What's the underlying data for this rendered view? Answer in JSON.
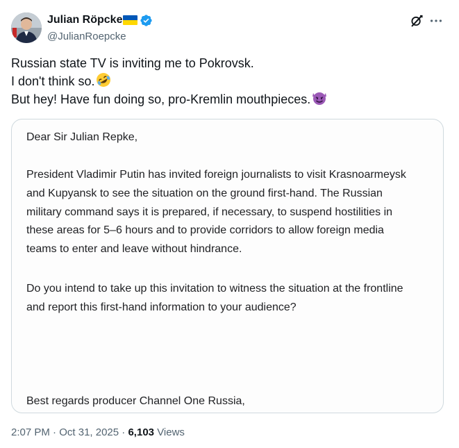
{
  "author": {
    "name": "Julian Röpcke",
    "handle": "@JulianRoepcke",
    "verified_color": "#1d9bf0"
  },
  "tweet": {
    "lines": [
      "Russian state TV is inviting me to Pokrovsk.",
      "I don't think so.",
      "But hey! Have fun doing so, pro-Kremlin mouthpieces."
    ],
    "emojis": [
      "rolling-on-floor-laughing",
      "smiling-face-with-horns"
    ]
  },
  "letter": {
    "greeting": "Dear Sir Julian Repke,",
    "body_lines": [
      "President Vladimir Putin has invited foreign journalists to visit Krasnoarmeysk",
      "and Kupyansk to see the situation on the ground first-hand. The Russian",
      "military command says it is prepared, if necessary, to suspend hostilities in",
      "these areas for 5–6 hours and to provide corridors to allow foreign media",
      "teams to enter and leave without hindrance."
    ],
    "question_lines": [
      "Do you intend to take up this invitation to witness the situation at the frontline",
      "and report this first-hand information to your audience?"
    ],
    "signoff": "Best regards producer Channel One Russia,"
  },
  "meta": {
    "time": "2:07 PM",
    "separator": "·",
    "date": "Oct 31, 2025",
    "views_count": "6,103",
    "views_label": "Views"
  },
  "colors": {
    "text": "#0f1419",
    "secondary": "#536471",
    "border": "#cfd9de",
    "flag_blue": "#0057b7",
    "flag_yellow": "#ffd700"
  }
}
